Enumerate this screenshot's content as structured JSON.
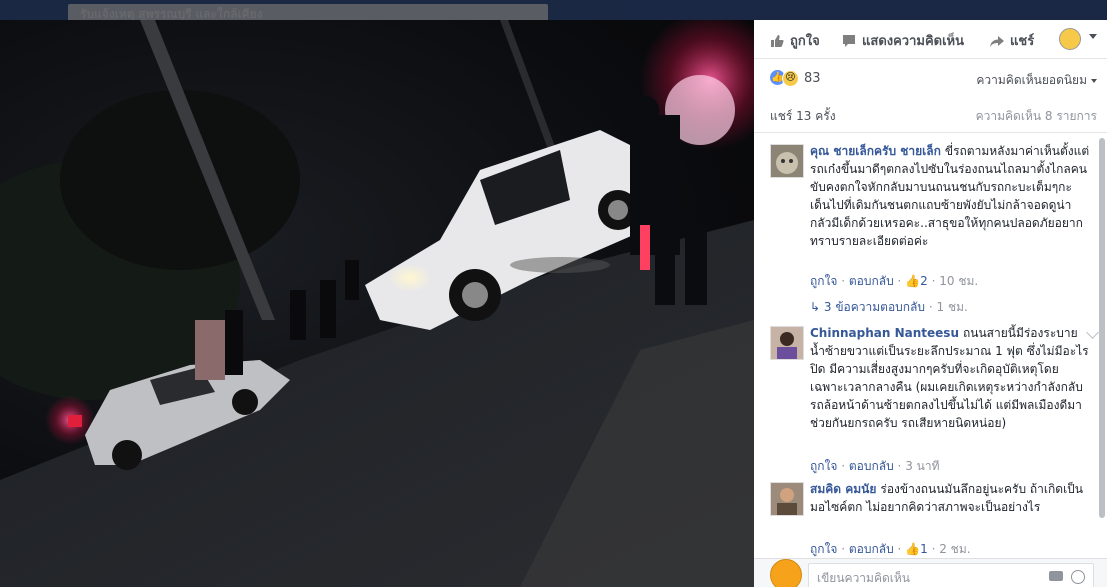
{
  "topbar": {
    "page_name": "รับแจ้งเหตุ สุพรรณบุรี และใกล้เคียง"
  },
  "actions": {
    "like": "ถูกใจ",
    "comment": "แสดงความคิดเห็น",
    "share": "แชร์"
  },
  "reactions": {
    "count": "83",
    "sort_label": "ความคิดเห็นยอดนิยม"
  },
  "stats": {
    "shares": "แชร์ 13 ครั้ง",
    "comments": "ความคิดเห็น 8 รายการ"
  },
  "comments": [
    {
      "name": "คุณ ชายเล็กครับ ชายเล็ก",
      "text": "ขี่รถตามหลังมาค่าเห็นตั้งแต่รถเก๋งขึ้นมาดีๆตกลงไปซับในร่องถนนไถลมาตั้งไกลคนขับคงตกใจหักกลับมาบนถนนชนกับรถกะบะเต็มๆกะเด็นไปที่เดิมกันชนตกแถบซ้ายพังยับไม่กล้าจอดดูน่ากลัวมีเด็กด้วยเหรอคะ..สาธุขอให้ทุกคนปลอดภัยอยากทราบรายละเอียดต่อค่ะ",
      "like": "ถูกใจ",
      "reply": "ตอบกลับ",
      "likes": "2",
      "time": "10 ชม.",
      "replies": "3 ข้อความตอบกลับ",
      "replies_time": "1 ชม."
    },
    {
      "name": "Chinnaphan Nanteesu",
      "text": "ถนนสายนี้มีร่องระบายน้ำซ้ายขวาแต่เป็นระยะลึกประมาณ 1 ฟุต ซึ่งไม่มีอะไรปิด มีความเสี่ยงสูงมากๆครับที่จะเกิดอุบัติเหตุโดยเฉพาะเวลากลางคืน (ผมเคยเกิดเหตุระหว่างกำลังกลับรถล้อหน้าด้านซ้ายตกลงไปขึ้นไม่ได้ แต่มีพลเมืองดีมาช่วยกันยกรถครับ รถเสียหายนิดหน่อย)",
      "like": "ถูกใจ",
      "reply": "ตอบกลับ",
      "time": "3 นาที"
    },
    {
      "name": "สมคิด คมนัย",
      "text": "ร่องข้างถนนมันลึกอยู่นะครับ ถ้าเกิดเป็นมอไซค์ตก ไม่อยากคิดว่าสภาพจะเป็นอย่างไร",
      "like": "ถูกใจ",
      "reply": "ตอบกลับ",
      "likes": "1",
      "time": "2 ชม."
    }
  ],
  "compose": {
    "placeholder": "เขียนความคิดเห็น"
  }
}
